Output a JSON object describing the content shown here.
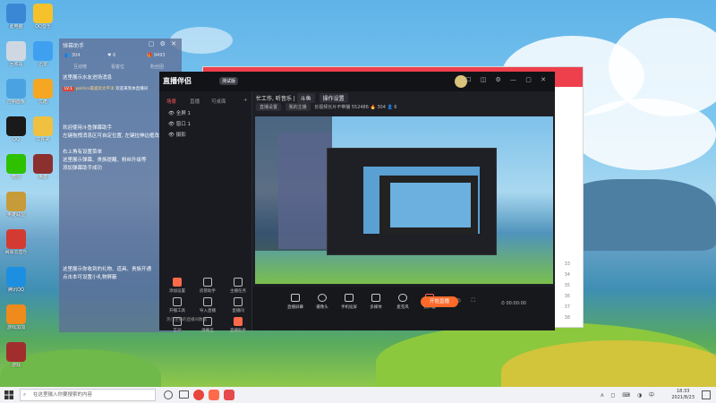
{
  "desktop": {
    "icons_col1": [
      {
        "label": "此电脑",
        "color": "#3a87d6"
      },
      {
        "label": "回收站",
        "color": "#cfd8e2"
      },
      {
        "label": "控制面板",
        "color": "#4aa3e0"
      },
      {
        "label": "QQ",
        "color": "#1a1a1a"
      },
      {
        "label": "微信",
        "color": "#2dc100"
      },
      {
        "label": "英雄联盟",
        "color": "#c69b3a"
      },
      {
        "label": "网易云音乐",
        "color": "#d33a31"
      },
      {
        "label": "腾讯QQ",
        "color": "#1d8fe0"
      },
      {
        "label": "游戏加加",
        "color": "#ef8a1c"
      },
      {
        "label": "游戏",
        "color": "#a22d2d"
      }
    ],
    "icons_col2": [
      {
        "label": "QQ音乐",
        "color": "#f5c22c"
      },
      {
        "label": "迅雷",
        "color": "#3fa0f2"
      },
      {
        "label": "优酷",
        "color": "#f5a623"
      },
      {
        "label": "文件夹",
        "color": "#f0c040"
      },
      {
        "label": "英雄",
        "color": "#8c2f2f"
      }
    ]
  },
  "assistant": {
    "title": "弹幕助手",
    "win_buttons": "▢ ⚙ ✕",
    "stats": [
      "304",
      "6",
      "9493"
    ],
    "tabs": [
      "互动榜",
      "看客位",
      "粉丝团"
    ],
    "messages": [
      "这里展示水友进场消息",
      "欢迎来到本直播间",
      "欢迎使用斗鱼弹幕助手",
      "左键拖拽消息区可自定位置, 左键拉伸边框改变大小",
      "右上角有设置菜单",
      "这里展示弹幕、贵族提醒、粉丝升级等",
      "添加弹幕助手成功",
      "这里展示你收到的礼物、道具、贵族开通",
      "点击本可设置小礼物屏蔽"
    ],
    "badge": "LV.1",
    "user": "politics最喜欢太平洋"
  },
  "app": {
    "logo": "直播伴侣",
    "version": "测试版",
    "window_controls": "☐ ◫ ⚙ — ▢ ✕",
    "scene_tabs": [
      "场景",
      "直播",
      "可桌面",
      "+"
    ],
    "scenes": [
      "全屏 1",
      "窗口 1",
      "摄影"
    ],
    "tools": [
      {
        "label": "添加设置",
        "hot": true
      },
      {
        "label": "房管助手",
        "hot": false
      },
      {
        "label": "主播任务",
        "hot": false
      },
      {
        "label": "开播工具",
        "hot": false
      },
      {
        "label": "导入直播",
        "hot": false
      },
      {
        "label": "直播间",
        "hot": false
      },
      {
        "label": "互动",
        "hot": false
      },
      {
        "label": "弹幕宝",
        "hot": false
      },
      {
        "label": "直播助手",
        "hot": true
      }
    ],
    "stream_title": "忙工作, 听音乐 |",
    "room_meta": [
      "斗鱼",
      "操作设置"
    ],
    "meta2": [
      "直播设置",
      "我的主播",
      "长视频长片不带播",
      "552486",
      "304",
      "6"
    ],
    "bottom_buttons": [
      "直播屏幕",
      "摄像头",
      "手机投屏",
      "多媒体",
      "麦克风",
      "扬声器"
    ],
    "start_label": "开始直播",
    "timer": "00:00:00",
    "status_text": "热门主播的直播间数据"
  },
  "redwin": {
    "list": [
      "33",
      "34",
      "35",
      "36",
      "37",
      "38"
    ]
  },
  "taskbar": {
    "search_placeholder": "在这里输入你要搜索的内容",
    "time": "18:33",
    "date": "2021/8/23",
    "tray": "ʌ ◻ ⌨ ◑ 中"
  }
}
